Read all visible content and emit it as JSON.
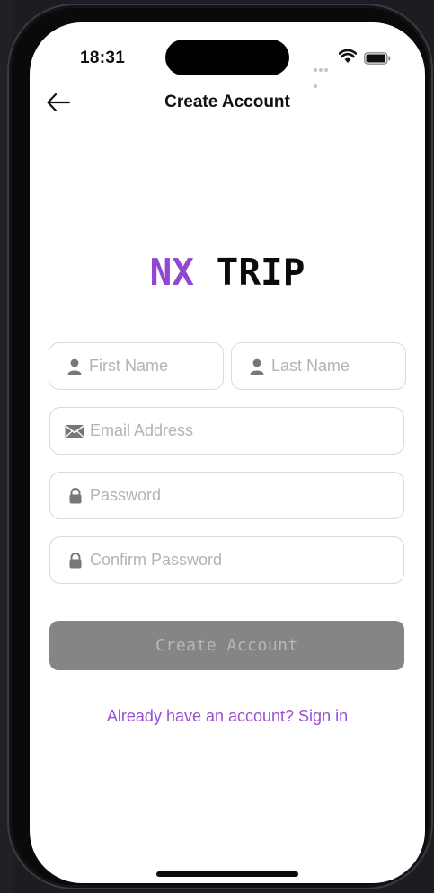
{
  "status_bar": {
    "time": "18:31"
  },
  "nav": {
    "title": "Create Account"
  },
  "logo": {
    "part1": "NX",
    "part2": "TRIP"
  },
  "form": {
    "first_name": {
      "placeholder": "First Name",
      "value": ""
    },
    "last_name": {
      "placeholder": "Last Name",
      "value": ""
    },
    "email": {
      "placeholder": "Email Address",
      "value": ""
    },
    "password": {
      "placeholder": "Password",
      "value": ""
    },
    "confirm_password": {
      "placeholder": "Confirm Password",
      "value": ""
    }
  },
  "actions": {
    "create_label": "Create Account",
    "signin_link": "Already have an account? Sign in"
  },
  "colors": {
    "accent": "#9147d4",
    "button_bg": "#858585",
    "placeholder": "#b3b3b8",
    "link": "#9a4fd0"
  },
  "icons": [
    "back-arrow-icon",
    "person-icon",
    "envelope-icon",
    "lock-icon",
    "wifi-icon",
    "battery-icon",
    "signal-dots-icon"
  ]
}
